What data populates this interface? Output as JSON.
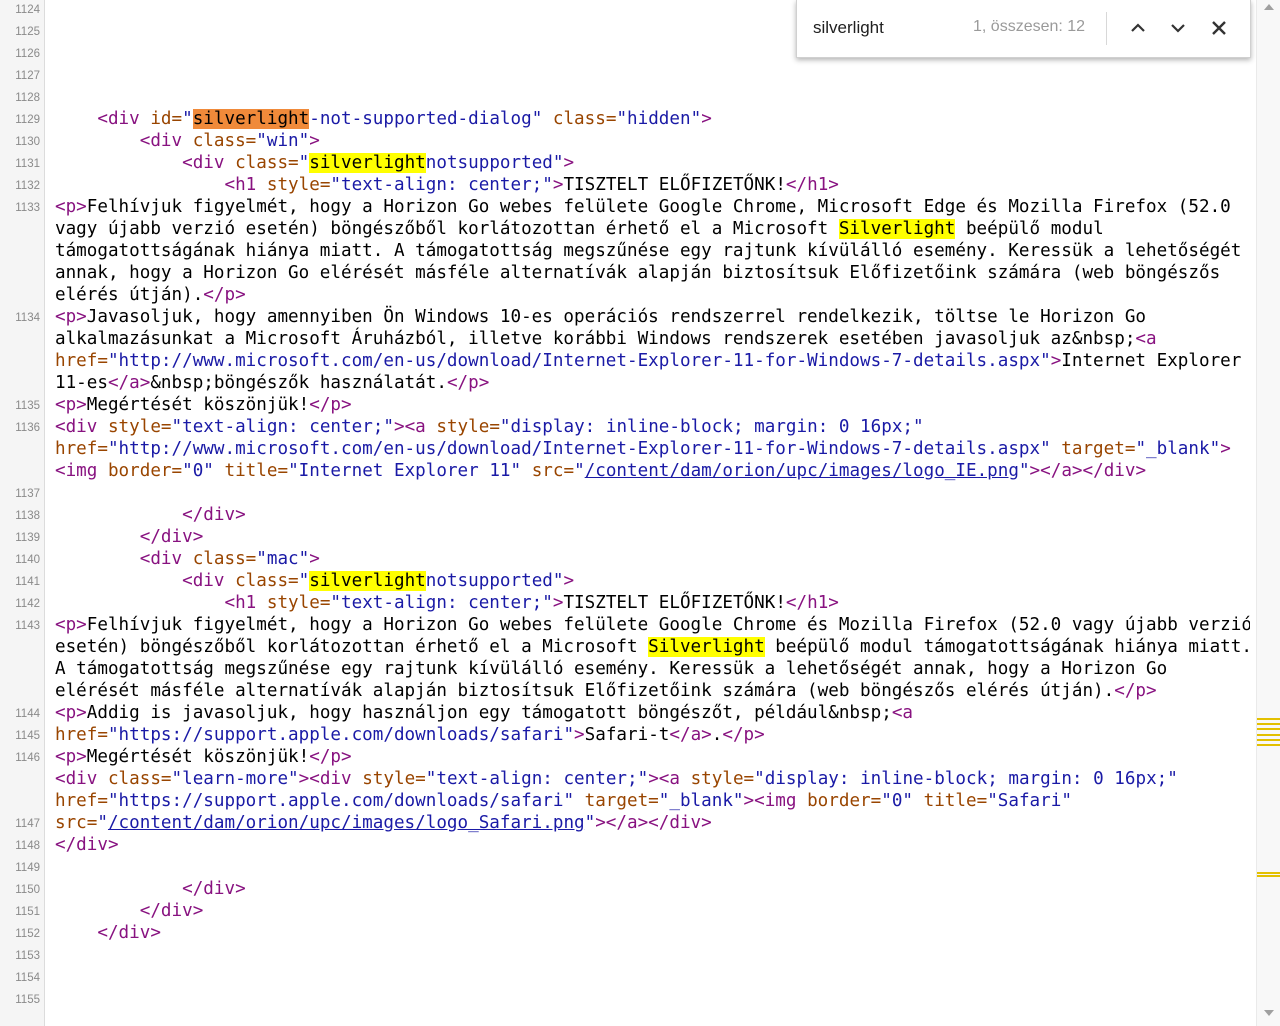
{
  "find_bar": {
    "query": "silverlight",
    "match_count": "1, összesen: 12",
    "prev_icon": "chevron-up-icon",
    "next_icon": "chevron-down-icon",
    "close_icon": "close-icon"
  },
  "colors": {
    "tag": "#881280",
    "attribute": "#994500",
    "value": "#1a1aa6",
    "match_highlight": "#ffff00",
    "current_match": "#f08a3a"
  },
  "line_numbers": [
    "1124",
    "1125",
    "1126",
    "1127",
    "1128",
    "1129",
    "1130",
    "1131",
    "1132",
    "1133",
    "1134",
    "1135",
    "1136",
    "1137",
    "1138",
    "1139",
    "1140",
    "1141",
    "1142",
    "1143",
    "1144",
    "1145",
    "1146",
    "1147",
    "1148",
    "1149",
    "1150",
    "1151",
    "1152",
    "1153",
    "1154",
    "1155"
  ],
  "line_number_rows": [
    0,
    1,
    2,
    3,
    4,
    5,
    6,
    7,
    8,
    9,
    14,
    18,
    19,
    22,
    23,
    24,
    25,
    26,
    27,
    28,
    32,
    33,
    34,
    37,
    38,
    39,
    40,
    41,
    42,
    43,
    44,
    45
  ],
  "code_rows": [
    [],
    [],
    [],
    [],
    [],
    [
      [
        "    ",
        ""
      ],
      [
        "<div ",
        "t"
      ],
      [
        "id=",
        "a"
      ],
      [
        "\"",
        "v"
      ],
      [
        "silverlight",
        "cur"
      ],
      [
        "-not-supported-dialog\" ",
        "v"
      ],
      [
        "class=",
        "a"
      ],
      [
        "\"hidden\"",
        "v"
      ],
      [
        ">",
        "t"
      ]
    ],
    [
      [
        "        ",
        ""
      ],
      [
        "<div ",
        "t"
      ],
      [
        "class=",
        "a"
      ],
      [
        "\"win\"",
        "v"
      ],
      [
        ">",
        "t"
      ]
    ],
    [
      [
        "            ",
        ""
      ],
      [
        "<div ",
        "t"
      ],
      [
        "class=",
        "a"
      ],
      [
        "\"",
        "v"
      ],
      [
        "silverlight",
        "hl"
      ],
      [
        "notsupported\"",
        "v"
      ],
      [
        ">",
        "t"
      ]
    ],
    [
      [
        "                ",
        ""
      ],
      [
        "<h1 ",
        "t"
      ],
      [
        "style=",
        "a"
      ],
      [
        "\"text-align: center;\"",
        "v"
      ],
      [
        ">",
        "t"
      ],
      [
        "TISZTELT ELŐFIZETŐNK!",
        ""
      ],
      [
        "</h1>",
        "t"
      ]
    ],
    [
      [
        "<p>",
        "t"
      ],
      [
        "Felhívjuk figyelmét, hogy a Horizon Go webes felülete Google Chrome, Microsoft Edge és Mozilla Firefox (52.0",
        ""
      ]
    ],
    [
      [
        "vagy újabb verzió esetén) böngészőből korlátozottan érhető el a Microsoft ",
        ""
      ],
      [
        "Silverlight",
        "hl"
      ],
      [
        " beépülő modul",
        ""
      ]
    ],
    [
      [
        "támogatottságának hiánya miatt. A támogatottság megszűnése egy rajtunk kívülálló esemény. Keressük a lehetőségét",
        ""
      ]
    ],
    [
      [
        "annak, hogy a Horizon Go elérését másféle alternatívák alapján biztosítsuk Előfizetőink számára (web böngészős",
        ""
      ]
    ],
    [
      [
        "elérés útján).",
        ""
      ],
      [
        "</p>",
        "t"
      ]
    ],
    [
      [
        "<p>",
        "t"
      ],
      [
        "Javasoljuk, hogy amennyiben Ön Windows 10-es operációs rendszerrel rendelkezik, töltse le Horizon Go",
        ""
      ]
    ],
    [
      [
        "alkalmazásunkat a Microsoft Áruházból, illetve korábbi Windows rendszerek esetében javasoljuk az&nbsp;",
        ""
      ],
      [
        "<a",
        "t"
      ]
    ],
    [
      [
        "href=",
        "a"
      ],
      [
        "\"http://www.microsoft.com/en-us/download/Internet-Explorer-11-for-Windows-7-details.aspx\"",
        "v"
      ],
      [
        ">",
        "t"
      ],
      [
        "Internet Explorer",
        ""
      ]
    ],
    [
      [
        "11-es",
        ""
      ],
      [
        "</a>",
        "t"
      ],
      [
        "&nbsp;böngészők használatát.",
        ""
      ],
      [
        "</p>",
        "t"
      ]
    ],
    [
      [
        "<p>",
        "t"
      ],
      [
        "Megértését köszönjük!",
        ""
      ],
      [
        "</p>",
        "t"
      ]
    ],
    [
      [
        "<div ",
        "t"
      ],
      [
        "style=",
        "a"
      ],
      [
        "\"text-align: center;\"",
        "v"
      ],
      [
        ">",
        "t"
      ],
      [
        "<a ",
        "t"
      ],
      [
        "style=",
        "a"
      ],
      [
        "\"display: inline-block; margin: 0 16px;\"",
        "v"
      ]
    ],
    [
      [
        "href=",
        "a"
      ],
      [
        "\"http://www.microsoft.com/en-us/download/Internet-Explorer-11-for-Windows-7-details.aspx\" ",
        "v"
      ],
      [
        "target=",
        "a"
      ],
      [
        "\"_blank\"",
        "v"
      ],
      [
        ">",
        "t"
      ]
    ],
    [
      [
        "<img ",
        "t"
      ],
      [
        "border=",
        "a"
      ],
      [
        "\"0\" ",
        "v"
      ],
      [
        "title=",
        "a"
      ],
      [
        "\"Internet Explorer 11\" ",
        "v"
      ],
      [
        "src=",
        "a"
      ],
      [
        "\"",
        "v"
      ],
      [
        "/content/dam/orion/upc/images/logo_IE.png",
        "l"
      ],
      [
        "\"",
        "v"
      ],
      [
        "></a></div>",
        "t"
      ]
    ],
    [],
    [
      [
        "            ",
        ""
      ],
      [
        "</div>",
        "t"
      ]
    ],
    [
      [
        "        ",
        ""
      ],
      [
        "</div>",
        "t"
      ]
    ],
    [
      [
        "        ",
        ""
      ],
      [
        "<div ",
        "t"
      ],
      [
        "class=",
        "a"
      ],
      [
        "\"mac\"",
        "v"
      ],
      [
        ">",
        "t"
      ]
    ],
    [
      [
        "            ",
        ""
      ],
      [
        "<div ",
        "t"
      ],
      [
        "class=",
        "a"
      ],
      [
        "\"",
        "v"
      ],
      [
        "silverlight",
        "hl"
      ],
      [
        "notsupported\"",
        "v"
      ],
      [
        ">",
        "t"
      ]
    ],
    [
      [
        "                ",
        ""
      ],
      [
        "<h1 ",
        "t"
      ],
      [
        "style=",
        "a"
      ],
      [
        "\"text-align: center;\"",
        "v"
      ],
      [
        ">",
        "t"
      ],
      [
        "TISZTELT ELŐFIZETŐNK!",
        ""
      ],
      [
        "</h1>",
        "t"
      ]
    ],
    [
      [
        "<p>",
        "t"
      ],
      [
        "Felhívjuk figyelmét, hogy a Horizon Go webes felülete Google Chrome és Mozilla Firefox (52.0 vagy újabb verzió",
        ""
      ]
    ],
    [
      [
        "esetén) böngészőből korlátozottan érhető el a Microsoft ",
        ""
      ],
      [
        "Silverlight",
        "hl"
      ],
      [
        " beépülő modul támogatottságának hiánya miatt.",
        ""
      ]
    ],
    [
      [
        "A támogatottság megszűnése egy rajtunk kívülálló esemény. Keressük a lehetőségét annak, hogy a Horizon Go",
        ""
      ]
    ],
    [
      [
        "elérését másféle alternatívák alapján biztosítsuk Előfizetőink számára (web böngészős elérés útján).",
        ""
      ],
      [
        "</p>",
        "t"
      ]
    ],
    [
      [
        "<p>",
        "t"
      ],
      [
        "Addig is javasoljuk, hogy használjon egy támogatott böngészőt, például&nbsp;",
        ""
      ],
      [
        "<a",
        "t"
      ]
    ],
    [
      [
        "href=",
        "a"
      ],
      [
        "\"https://support.apple.com/downloads/safari\"",
        "v"
      ],
      [
        ">",
        "t"
      ],
      [
        "Safari-t",
        ""
      ],
      [
        "</a>",
        "t"
      ],
      [
        ".",
        ""
      ],
      [
        "</p>",
        "t"
      ]
    ],
    [
      [
        "<p>",
        "t"
      ],
      [
        "Megértését köszönjük!",
        ""
      ],
      [
        "</p>",
        "t"
      ]
    ],
    [
      [
        "<div ",
        "t"
      ],
      [
        "class=",
        "a"
      ],
      [
        "\"learn-more\"",
        "v"
      ],
      [
        "><div ",
        "t"
      ],
      [
        "style=",
        "a"
      ],
      [
        "\"text-align: center;\"",
        "v"
      ],
      [
        "><a ",
        "t"
      ],
      [
        "style=",
        "a"
      ],
      [
        "\"display: inline-block; margin: 0 16px;\"",
        "v"
      ]
    ],
    [
      [
        "href=",
        "a"
      ],
      [
        "\"https://support.apple.com/downloads/safari\" ",
        "v"
      ],
      [
        "target=",
        "a"
      ],
      [
        "\"_blank\"",
        "v"
      ],
      [
        "><img ",
        "t"
      ],
      [
        "border=",
        "a"
      ],
      [
        "\"0\" ",
        "v"
      ],
      [
        "title=",
        "a"
      ],
      [
        "\"Safari\"",
        "v"
      ]
    ],
    [
      [
        "src=",
        "a"
      ],
      [
        "\"",
        "v"
      ],
      [
        "/content/dam/orion/upc/images/logo_Safari.png",
        "l"
      ],
      [
        "\"",
        "v"
      ],
      [
        "></a></div>",
        "t"
      ]
    ],
    [
      [
        "</div>",
        "t"
      ]
    ],
    [],
    [
      [
        "            ",
        ""
      ],
      [
        "</div>",
        "t"
      ]
    ],
    [
      [
        "        ",
        ""
      ],
      [
        "</div>",
        "t"
      ]
    ],
    [
      [
        "    ",
        ""
      ],
      [
        "</div>",
        "t"
      ]
    ],
    [],
    [],
    [],
    []
  ],
  "scroll_markers": [
    0.7,
    0.705,
    0.71,
    0.715,
    0.72,
    0.725,
    0.85,
    0.853
  ]
}
